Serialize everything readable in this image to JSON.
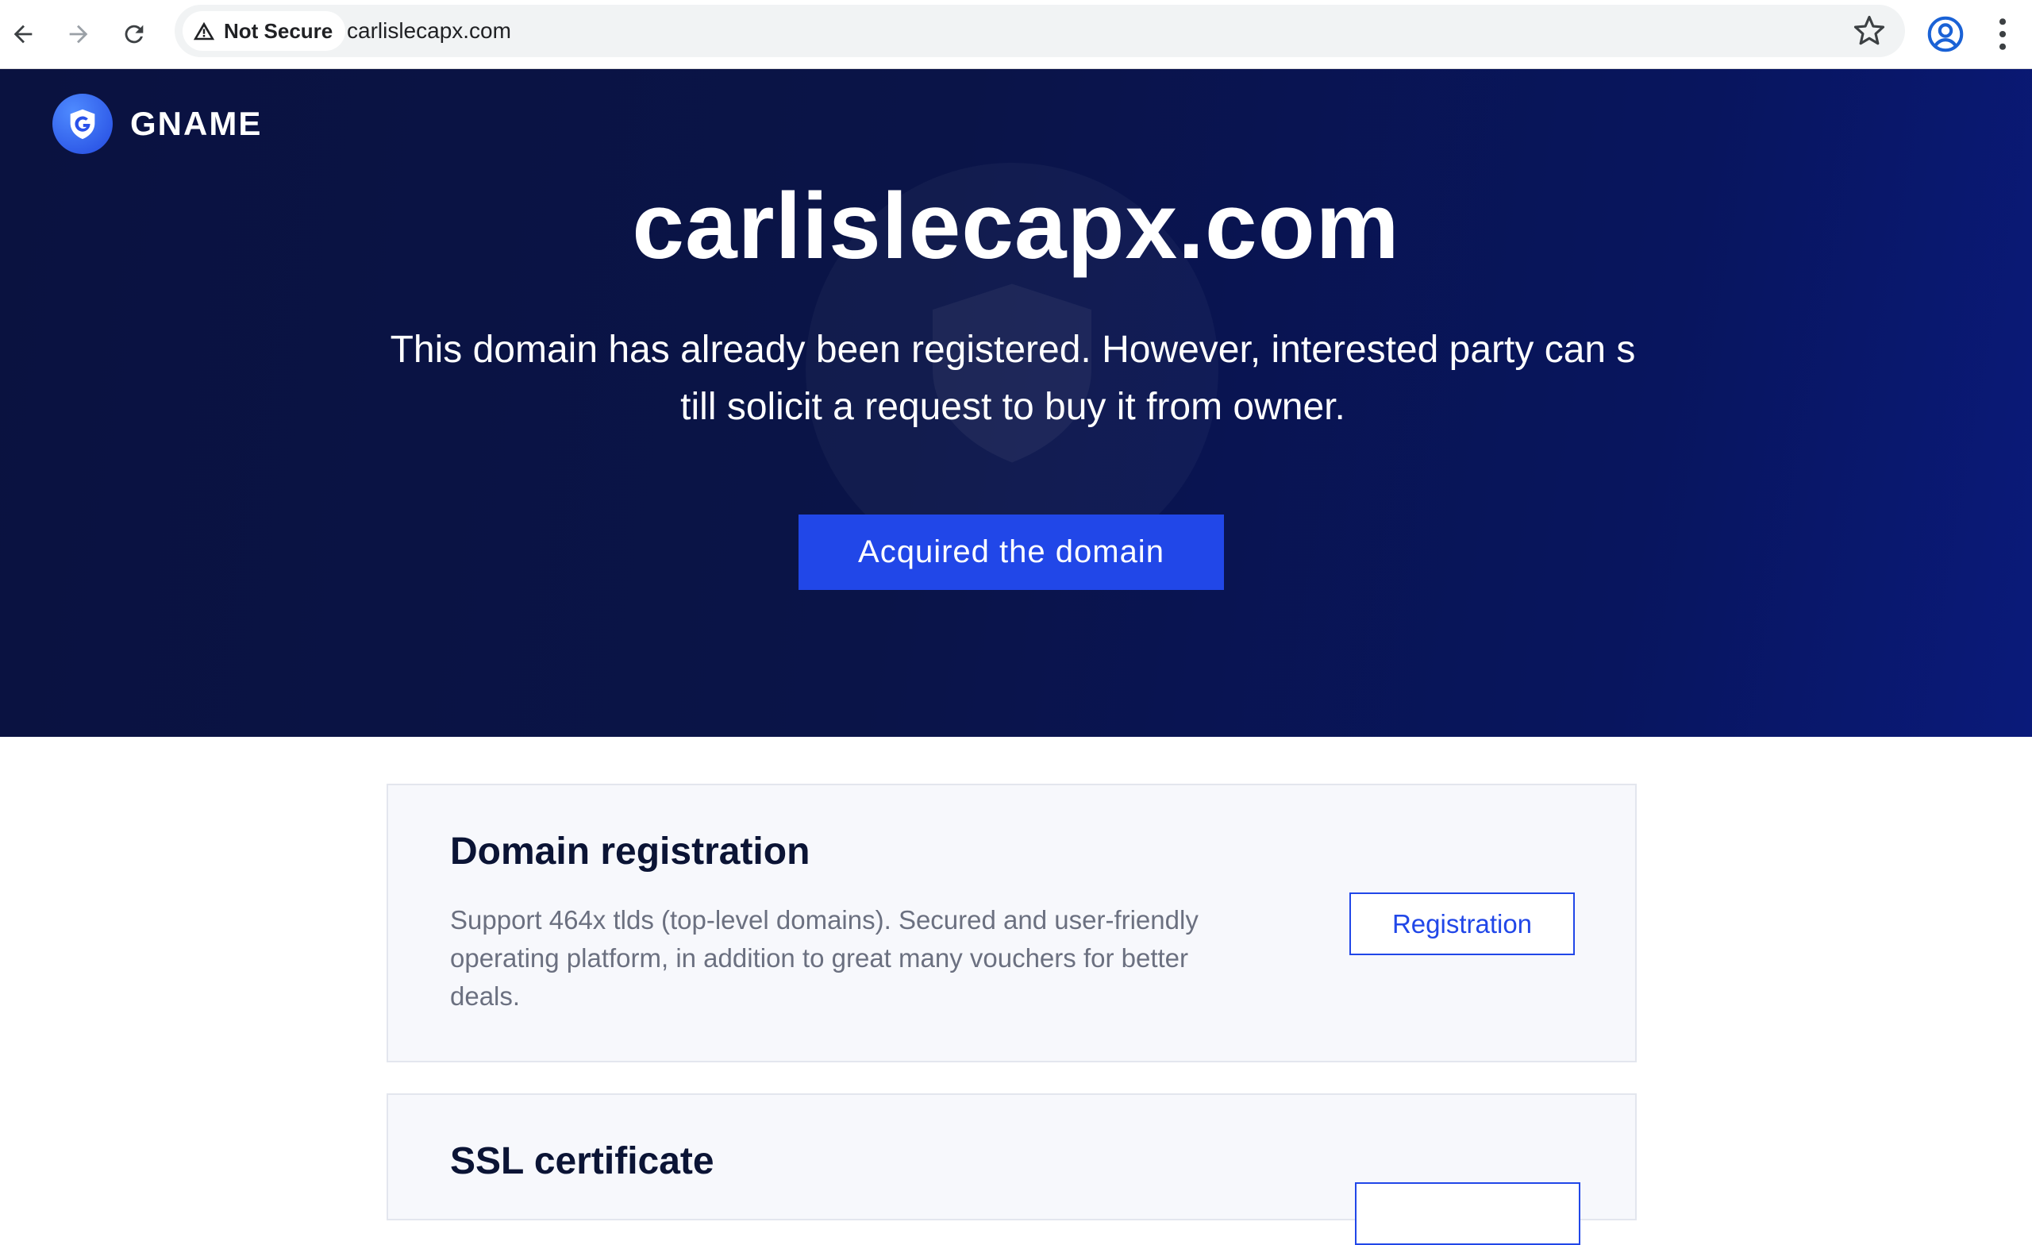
{
  "browser": {
    "security_label": "Not Secure",
    "url": "carlislecapx.com",
    "icons": [
      "back-arrow-icon",
      "forward-arrow-icon",
      "reload-icon",
      "warning-icon",
      "bookmark-star-icon",
      "profile-icon",
      "more-menu-icon"
    ]
  },
  "brand": {
    "name": "GNAME",
    "logo_icon": "gname-logo-icon"
  },
  "hero": {
    "title": "carlislecapx.com",
    "subtitle": "This domain has already been registered. However, interested party can still solicit a request to buy it from owner.",
    "button_label": "Acquired the domain"
  },
  "cards": [
    {
      "title": "Domain registration",
      "description": "Support 464x tlds (top-level domains). Secured and user-friendly operating platform, in addition to great many vouchers for better deals.",
      "button_label": "Registration"
    },
    {
      "title": "SSL certificate"
    }
  ],
  "colors": {
    "hero_background": "#0a1448",
    "accent": "#2147e8",
    "card_background": "#f7f8fc",
    "card_title": "#0b1435",
    "card_text": "#6b7080"
  }
}
